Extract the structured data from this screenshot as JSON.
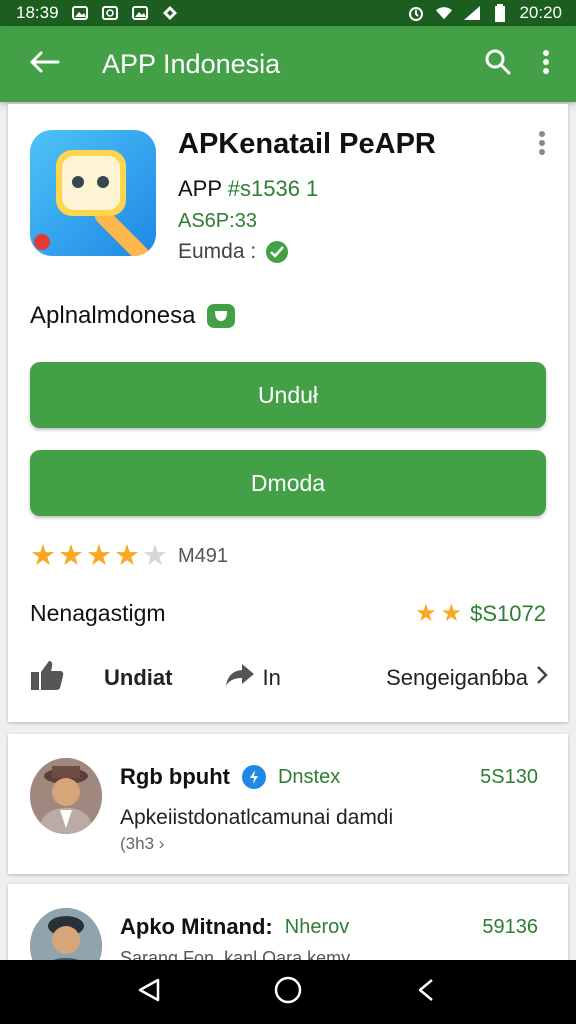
{
  "status_bar": {
    "time_left": "18:39",
    "time_right": "20:20",
    "icons": [
      "image-icon",
      "sync-icon",
      "image-icon",
      "diamond-icon",
      "alarm-icon",
      "wifi-icon",
      "signal-icon",
      "battery-icon"
    ]
  },
  "app_bar": {
    "title": "APP Indonesia",
    "icons": [
      "back-arrow-icon",
      "search-icon",
      "more-vert-icon"
    ]
  },
  "app": {
    "name": "APKenatail PeAPR",
    "developer_prefix": "APP",
    "developer_code": "#s1536 1",
    "version": "AS6P:33",
    "category": "Eumda :",
    "subtitle": "Aplnalmdonesa"
  },
  "buttons": {
    "primary": "Unduł",
    "secondary": "Dmoda"
  },
  "rating": {
    "stars": 4,
    "max": 5,
    "count": "M491"
  },
  "info": {
    "label": "Nenagastigm",
    "stars": 2,
    "value": "$S1072"
  },
  "actions": {
    "like_label": "Undiat",
    "share_label": "In",
    "more_label": "Sengeiganɓba"
  },
  "reviews": [
    {
      "name": "Rgb bpuht",
      "tag": "Dnstex",
      "score": "5S130",
      "body": "Apkeiistdonatlcamunai damdi",
      "meta": "(3h3 ›"
    },
    {
      "name": "Apko Mitnand:",
      "tag": "Nherov",
      "score": "59136",
      "body": "Sarang Fon. kanl Oara kemy"
    }
  ],
  "colors": {
    "status_bar": "#1b5e20",
    "primary": "#43a047",
    "accent_text": "#2e7d32",
    "star": "#f9a825"
  }
}
